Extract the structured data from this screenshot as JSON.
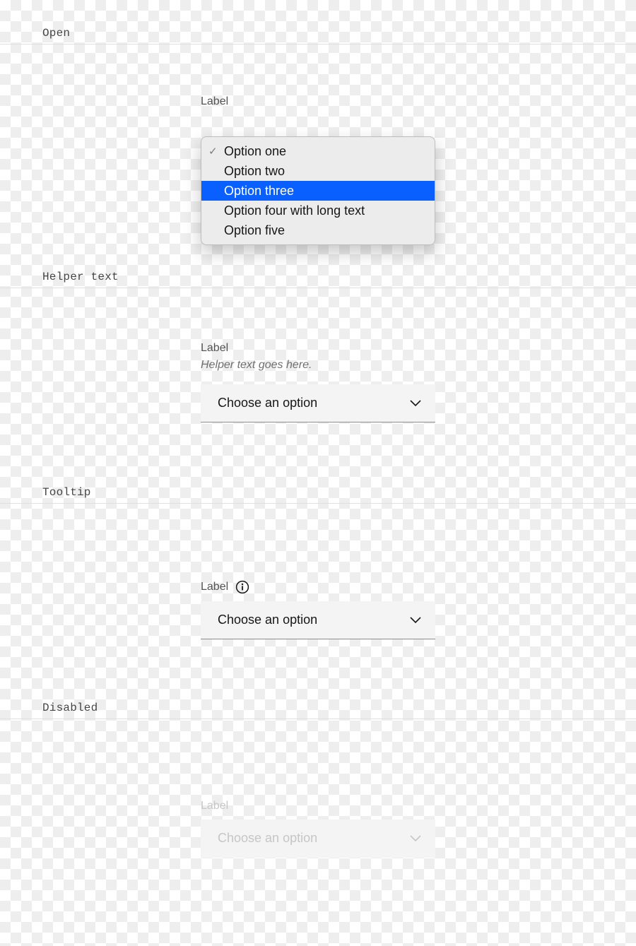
{
  "sections": {
    "open": {
      "heading": "Open"
    },
    "helper": {
      "heading": "Helper text"
    },
    "tooltip": {
      "heading": "Tooltip"
    },
    "disabled": {
      "heading": "Disabled"
    }
  },
  "open": {
    "label": "Label",
    "options": [
      "Option one",
      "Option two",
      "Option three",
      "Option four with long text",
      "Option five"
    ],
    "selected_index": 0,
    "highlighted_index": 2
  },
  "helper": {
    "label": "Label",
    "helper_text": "Helper text goes here.",
    "placeholder": "Choose an option"
  },
  "tooltip": {
    "label": "Label",
    "placeholder": "Choose an option",
    "info_icon": "information-icon"
  },
  "disabled": {
    "label": "Label",
    "placeholder": "Choose an option"
  }
}
